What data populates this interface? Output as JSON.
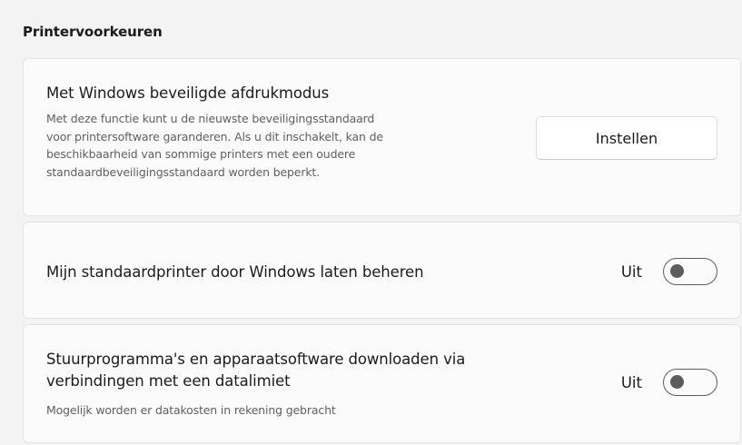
{
  "section": {
    "title": "Printervoorkeuren"
  },
  "secure_print": {
    "title": "Met Windows beveiligde afdrukmodus",
    "description_lines": [
      "Met deze functie kunt u de nieuwste beveiligingsstandaard",
      "voor printersoftware garanderen. Als u dit inschakelt, kan de",
      "beschikbaarheid van sommige printers met een oudere",
      "standaardbeveiligingsstandaard worden beperkt."
    ],
    "button_label": "Instellen"
  },
  "default_printer": {
    "title": "Mijn standaardprinter door Windows laten beheren",
    "state_label": "Uit",
    "toggle_on": false
  },
  "metered_download": {
    "title_lines": [
      "Stuurprogramma's en apparaatsoftware downloaden via",
      "verbindingen met een datalimiet"
    ],
    "description": "Mogelijk worden er datakosten in rekening gebracht",
    "state_label": "Uit",
    "toggle_on": false
  }
}
